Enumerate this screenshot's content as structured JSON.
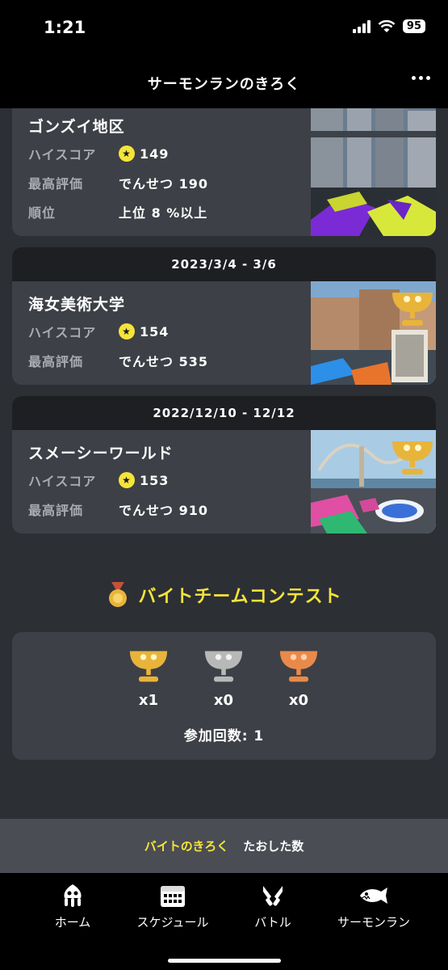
{
  "status": {
    "time": "1:21",
    "battery": "95"
  },
  "nav": {
    "title": "サーモンランのきろく"
  },
  "stats_labels": {
    "high_score": "ハイスコア",
    "best_rank": "最高評価",
    "ranking": "順位"
  },
  "stages": [
    {
      "name": "ゴンズイ地区",
      "high_score": "149",
      "best_rank": "でんせつ 190",
      "ranking": "上位 8 %以上"
    },
    {
      "date": "2023/3/4 - 3/6",
      "name": "海女美術大学",
      "high_score": "154",
      "best_rank": "でんせつ 535"
    },
    {
      "date": "2022/12/10 - 12/12",
      "name": "スメーシーワールド",
      "high_score": "153",
      "best_rank": "でんせつ 910"
    }
  ],
  "contest": {
    "title": "バイトチームコンテスト",
    "gold": "x1",
    "silver": "x0",
    "bronze": "x0",
    "participation": "参加回数: 1"
  },
  "sub_tabs": {
    "records": "バイトのきろく",
    "defeated": "たおした数"
  },
  "tab_bar": {
    "home": "ホーム",
    "schedule": "スケジュール",
    "battle": "バトル",
    "salmon_run": "サーモンラン"
  },
  "colors": {
    "accent": "#f5e43a",
    "gold": "#e9b43a",
    "silver": "#b8b8b8",
    "bronze": "#e98a4a"
  }
}
